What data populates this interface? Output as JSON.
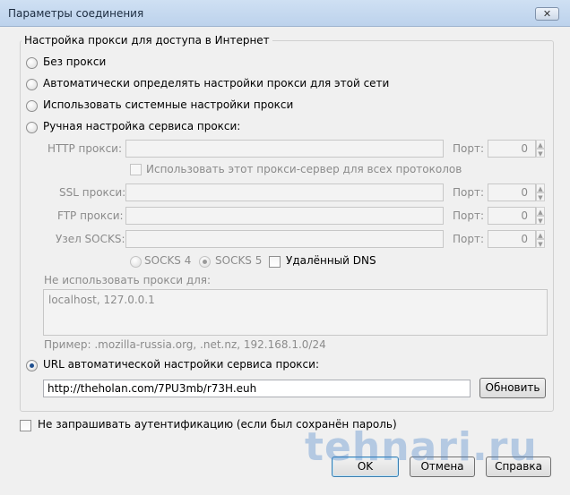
{
  "window": {
    "title": "Параметры соединения",
    "close_glyph": "✕"
  },
  "proxy_group": {
    "legend": "Настройка прокси для доступа в Интернет",
    "options": [
      {
        "label": "Без прокси",
        "selected": false
      },
      {
        "label": "Автоматически определять настройки прокси для этой сети",
        "selected": false
      },
      {
        "label": "Использовать системные настройки прокси",
        "selected": false
      },
      {
        "label": "Ручная настройка сервиса прокси:",
        "selected": false
      }
    ],
    "manual": {
      "http_label": "HTTP прокси:",
      "http_value": "",
      "port_label": "Порт:",
      "http_port": "0",
      "same_proxy_label": "Использовать этот прокси-сервер для всех протоколов",
      "ssl_label": "SSL прокси:",
      "ssl_value": "",
      "ssl_port": "0",
      "ftp_label": "FTP прокси:",
      "ftp_value": "",
      "ftp_port": "0",
      "socks_label": "Узел SOCKS:",
      "socks_value": "",
      "socks_port": "0",
      "socks4_label": "SOCKS 4",
      "socks5_label": "SOCKS 5",
      "socks5_selected": true,
      "remote_dns_label": "Удалённый DNS"
    },
    "no_proxy": {
      "label": "Не использовать прокси для:",
      "value": "localhost, 127.0.0.1",
      "example": "Пример: .mozilla-russia.org, .net.nz, 192.168.1.0/24"
    },
    "auto_url": {
      "label": "URL автоматической настройки сервиса прокси:",
      "selected": true,
      "value": "http://theholan.com/7PU3mb/r73H.euh",
      "reload_label": "Обновить"
    }
  },
  "no_auth_prompt_label": "Не запрашивать аутентификацию (если был сохранён пароль)",
  "buttons": {
    "ok": "OK",
    "cancel": "Отмена",
    "help": "Справка"
  },
  "watermark": "tehnari.ru",
  "icons": {
    "spin_up": "▲",
    "spin_down": "▼"
  }
}
